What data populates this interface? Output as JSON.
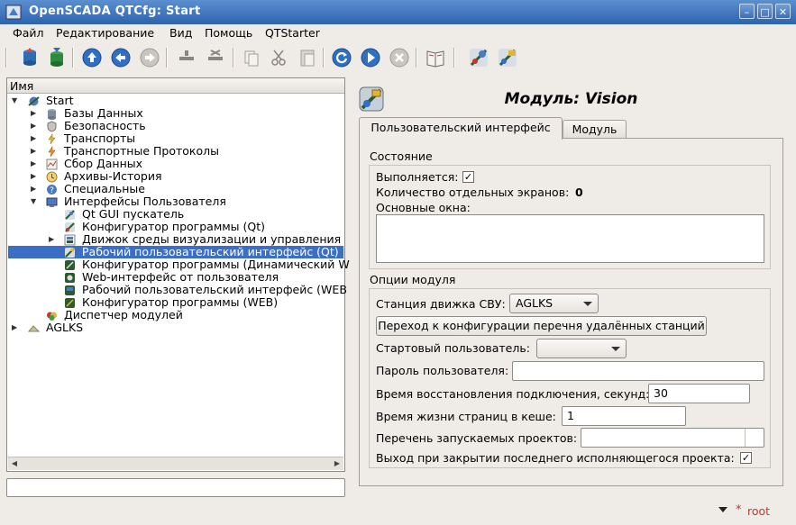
{
  "window": {
    "title": "OpenSCADA QTCfg: Start"
  },
  "menu": [
    "Файл",
    "Редактирование",
    "Вид",
    "Помощь",
    "QTStarter"
  ],
  "tree": {
    "header": "Имя",
    "items": [
      {
        "label": "Start",
        "icon": "station-icon",
        "expanded": true
      },
      {
        "label": "Базы Данных",
        "icon": "database-icon"
      },
      {
        "label": "Безопасность",
        "icon": "security-icon"
      },
      {
        "label": "Транспорты",
        "icon": "transport-icon"
      },
      {
        "label": "Транспортные Протоколы",
        "icon": "protocol-icon"
      },
      {
        "label": "Сбор Данных",
        "icon": "daq-icon"
      },
      {
        "label": "Архивы-История",
        "icon": "archive-icon"
      },
      {
        "label": "Специальные",
        "icon": "special-icon"
      },
      {
        "label": "Интерфейсы Пользователя",
        "icon": "ui-icon",
        "expanded": true
      },
      {
        "label": "Qt GUI пускатель",
        "icon": "qtstarter-icon"
      },
      {
        "label": "Конфигуратор программы (Qt)",
        "icon": "qtcfg-icon"
      },
      {
        "label": "Движок среды визуализации и управления",
        "icon": "vcaengine-icon"
      },
      {
        "label": "Рабочий пользовательский интерфейс (Qt)",
        "icon": "vision-icon",
        "selected": true
      },
      {
        "label": "Конфигуратор программы (Динамический W",
        "icon": "webcfgd-icon"
      },
      {
        "label": "Web-интерфейс от пользователя",
        "icon": "webuser-icon"
      },
      {
        "label": "Рабочий пользовательский интерфейс (WEB",
        "icon": "webvision-icon"
      },
      {
        "label": "Конфигуратор программы (WEB)",
        "icon": "webcfg-icon"
      },
      {
        "label": "Диспетчер модулей",
        "icon": "modsched-icon"
      },
      {
        "label": "AGLKS",
        "icon": "station-remote-icon"
      }
    ]
  },
  "page": {
    "title": "Модуль: Vision",
    "tabs": [
      "Пользовательский интерфейс",
      "Модуль"
    ],
    "state": {
      "group_label": "Состояние",
      "running_label": "Выполняется:",
      "running": true,
      "screens_label": "Количество отдельных экранов:",
      "screens_value": "0",
      "main_windows_label": "Основные окна:"
    },
    "options": {
      "group_label": "Опции модуля",
      "station_label": "Станция движка СВУ:",
      "station_value": "AGLKS",
      "goto_remote_button": "Переход к конфигурации перечня удалённых станций",
      "start_user_label": "Стартовый пользователь:",
      "start_user_value": "",
      "password_label": "Пароль пользователя:",
      "password_value": "",
      "restore_label": "Время восстановления подключения, секунд:",
      "restore_value": "30",
      "cache_label": "Время жизни страниц в кеше:",
      "cache_value": "1",
      "projects_label": "Перечень запускаемых проектов:",
      "projects_value": "",
      "exit_label": "Выход при закрытии последнего исполняющегося проекта:",
      "exit_checked": true
    }
  },
  "status": {
    "user": "root"
  }
}
